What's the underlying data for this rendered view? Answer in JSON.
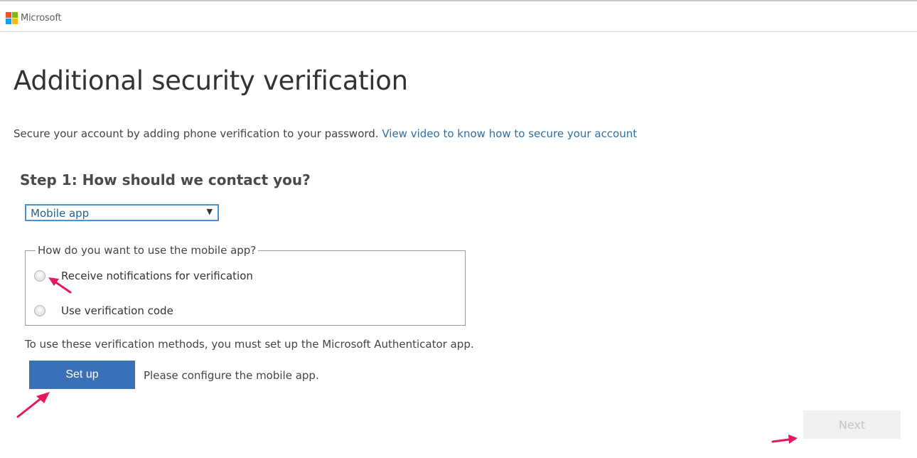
{
  "header": {
    "brand": "Microsoft",
    "logo_colors": [
      "#f25022",
      "#7fba00",
      "#00a4ef",
      "#ffb900"
    ]
  },
  "title": "Additional security verification",
  "intro": {
    "text": "Secure your account by adding phone verification to your password.",
    "link": "View video to know how to secure your account"
  },
  "step1": {
    "title": "Step 1: How should we contact you?",
    "method_select": {
      "value": "Mobile app"
    },
    "mobile_app_fieldset": {
      "legend": "How do you want to use the mobile app?",
      "options": [
        {
          "label": "Receive notifications for verification",
          "selected": false
        },
        {
          "label": "Use verification code",
          "selected": false
        }
      ]
    },
    "note": "To use these verification methods, you must set up the Microsoft Authenticator app.",
    "setup_button": "Set up",
    "configure_text": "Please configure the mobile app."
  },
  "footer": {
    "next_button": "Next",
    "next_enabled": false
  },
  "annotation_color": "#e8175d",
  "colors": {
    "accent": "#3a70b8",
    "link": "#2f6fa3",
    "select_border": "#4a90d4"
  }
}
